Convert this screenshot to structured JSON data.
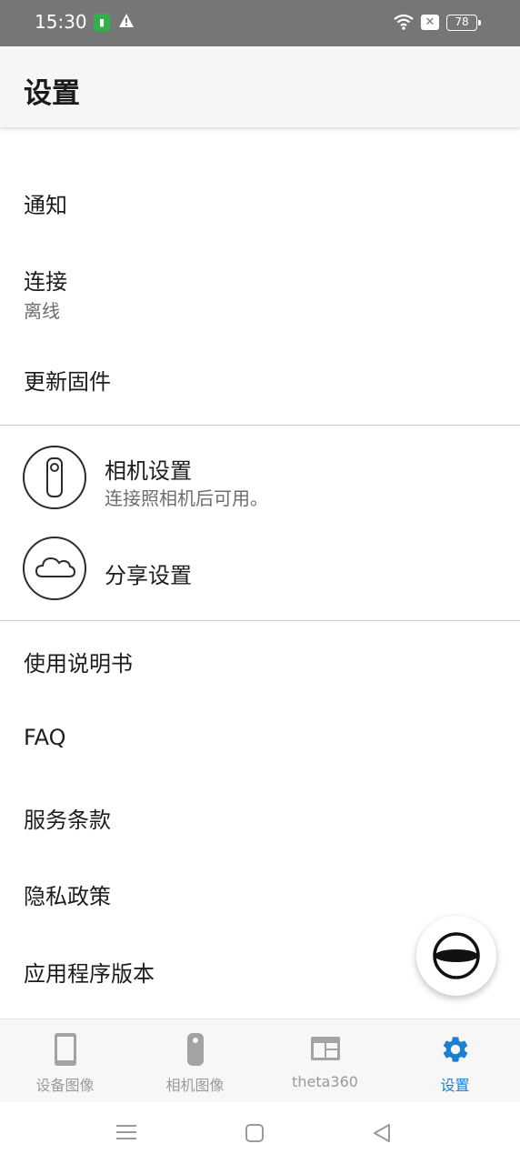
{
  "status_bar": {
    "time": "15:30",
    "battery": "78"
  },
  "app_bar": {
    "title": "设置"
  },
  "settings": {
    "notifications": "通知",
    "connection": {
      "label": "连接",
      "status": "离线"
    },
    "update_firmware": "更新固件",
    "camera_settings": {
      "label": "相机设置",
      "sub": "连接照相机后可用。"
    },
    "share_settings": "分享设置",
    "manual": "使用说明书",
    "faq": "FAQ",
    "terms": "服务条款",
    "privacy": "隐私政策",
    "app_version": "应用程序版本"
  },
  "bottom_nav": {
    "items": [
      {
        "label": "设备图像",
        "icon": "phone-icon"
      },
      {
        "label": "相机图像",
        "icon": "camera-icon"
      },
      {
        "label": "theta360",
        "icon": "browser-window-icon"
      },
      {
        "label": "设置",
        "icon": "gear-icon",
        "active": true
      }
    ]
  },
  "colors": {
    "accent": "#1c7fd3",
    "status_bar": "#767676"
  }
}
